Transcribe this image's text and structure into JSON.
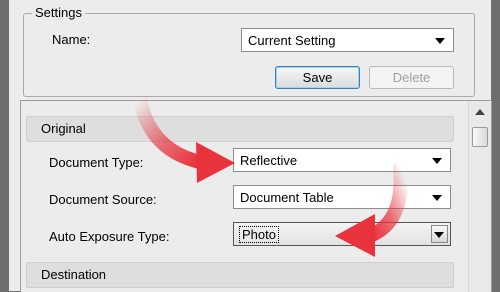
{
  "settings": {
    "group_label": "Settings",
    "name_label": "Name:",
    "name_value": "Current Setting",
    "save_label": "Save",
    "delete_label": "Delete"
  },
  "original": {
    "section_label": "Original",
    "document_type_label": "Document Type:",
    "document_type_value": "Reflective",
    "document_source_label": "Document Source:",
    "document_source_value": "Document Table",
    "auto_exposure_label": "Auto Exposure Type:",
    "auto_exposure_value": "Photo"
  },
  "destination": {
    "section_label": "Destination"
  },
  "colors": {
    "annotation_arrow": "#e8323c",
    "background": "#ececec"
  }
}
